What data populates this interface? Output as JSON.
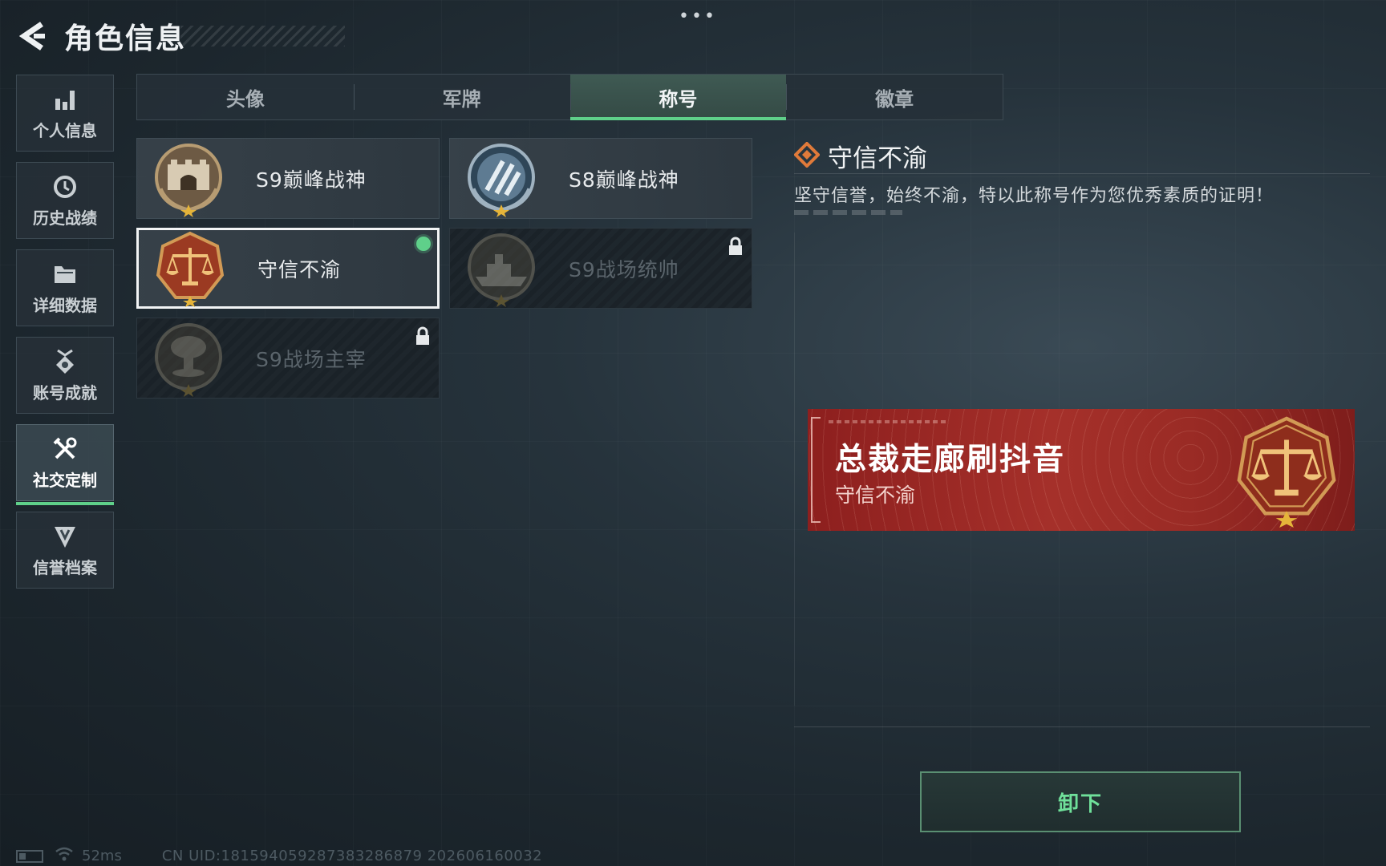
{
  "header": {
    "title": "角色信息",
    "back_icon": "back-arrow-icon",
    "more_icon": "•••"
  },
  "sidebar": {
    "items": [
      {
        "label": "个人信息",
        "icon": "bar-chart-icon",
        "active": false
      },
      {
        "label": "历史战绩",
        "icon": "clock-icon",
        "active": false
      },
      {
        "label": "详细数据",
        "icon": "folder-icon",
        "active": false
      },
      {
        "label": "账号成就",
        "icon": "badge-icon",
        "active": false
      },
      {
        "label": "社交定制",
        "icon": "tools-icon",
        "active": true
      },
      {
        "label": "信誉档案",
        "icon": "shield-icon",
        "active": false
      }
    ]
  },
  "tabs": [
    {
      "label": "头像",
      "active": false
    },
    {
      "label": "军牌",
      "active": false
    },
    {
      "label": "称号",
      "active": true
    },
    {
      "label": "徽章",
      "active": false
    }
  ],
  "titles": [
    {
      "name": "S9巅峰战神",
      "emblem": "fortress-emblem-icon",
      "locked": false,
      "selected": false,
      "equipped": false
    },
    {
      "name": "S8巅峰战神",
      "emblem": "blue-stripes-emblem-icon",
      "locked": false,
      "selected": false,
      "equipped": false
    },
    {
      "name": "守信不渝",
      "emblem": "scales-emblem-icon",
      "locked": false,
      "selected": true,
      "equipped": true
    },
    {
      "name": "S9战场统帅",
      "emblem": "warship-emblem-icon",
      "locked": true,
      "selected": false,
      "equipped": false
    },
    {
      "name": "S9战场主宰",
      "emblem": "mushroom-cloud-emblem-icon",
      "locked": true,
      "selected": false,
      "equipped": false
    }
  ],
  "detail": {
    "title": "守信不渝",
    "description": "坚守信誉，始终不渝，特以此称号作为您优秀素质的证明！"
  },
  "banner": {
    "player_name": "总裁走廊刷抖音",
    "title": "守信不渝",
    "emblem": "scales-emblem-icon"
  },
  "action": {
    "unequip_label": "卸下"
  },
  "status": {
    "ping": "52ms",
    "uid": "CN UID:18159405928738328687​9 202606160032"
  },
  "colors": {
    "accent": "#5fd08a",
    "banner_red": "#a5302a",
    "emblem_bronze": "#c88a4a"
  }
}
